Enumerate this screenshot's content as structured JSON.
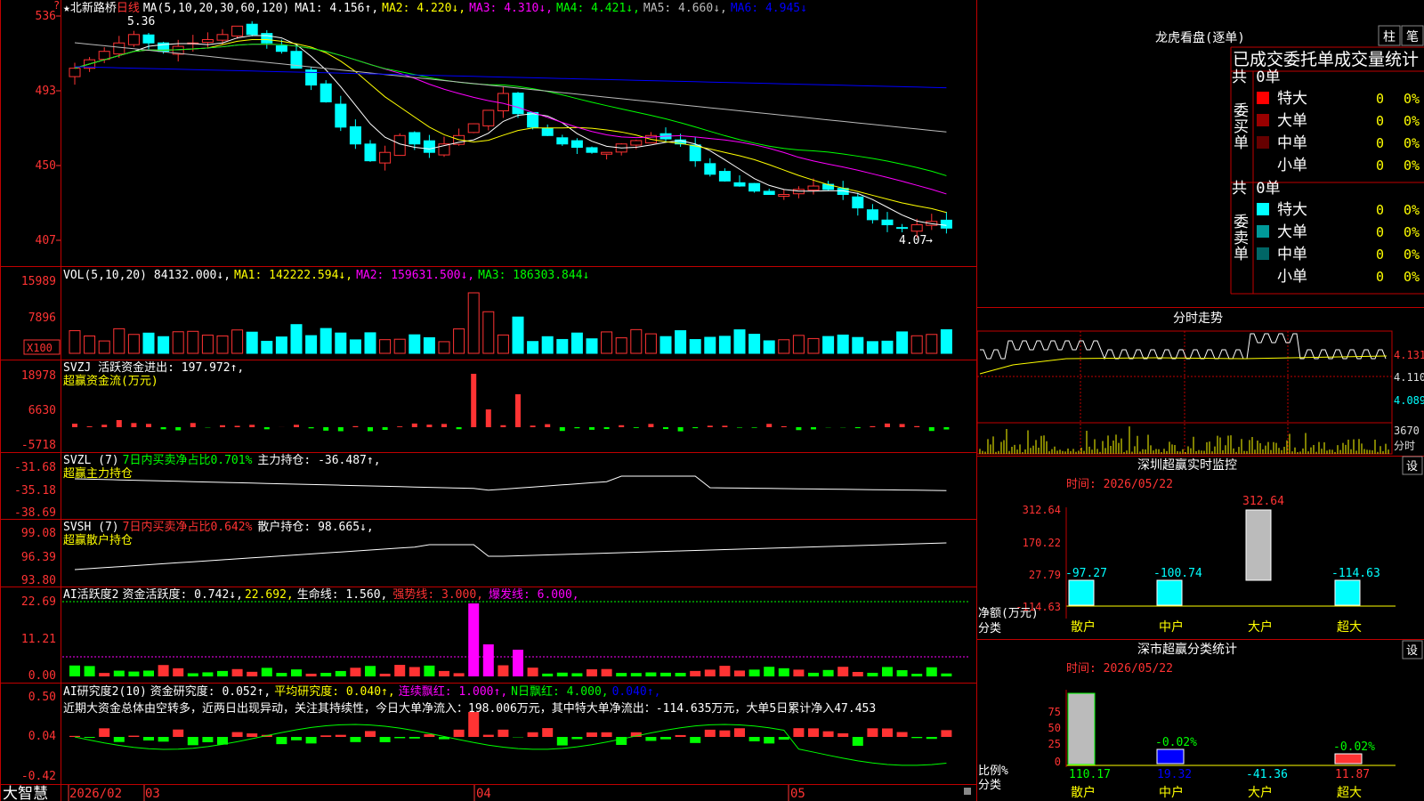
{
  "colors": {
    "up": "#ff3333",
    "down": "#00ffff",
    "frame": "#c00000",
    "ma1": "#ffffff",
    "ma2": "#ffff00",
    "ma3": "#ff00ff",
    "ma4": "#00ff00",
    "ma5": "#888888",
    "ma6": "#0000ff"
  },
  "main": {
    "star": "★",
    "stock_name": "北新路桥",
    "period": "日线",
    "ma_label": "MA(5,10,20,30,60,120)",
    "ma1": "MA1: 4.156↑,",
    "ma2": "MA2: 4.220↓,",
    "ma3": "MA3: 4.310↓,",
    "ma4": "MA4: 4.421↓,",
    "ma5": "MA5: 4.660↓,",
    "ma6": "MA6: 4.945↓",
    "y_labels": [
      "536",
      "493",
      "450",
      "407"
    ],
    "high_label": "5.36",
    "low_label": "4.07",
    "corner": "?"
  },
  "vol": {
    "label": "VOL(5,10,20)",
    "v": "84132.000↓,",
    "ma1": "MA1: 142222.594↓,",
    "ma2": "MA2: 159631.500↓,",
    "ma3": "MA3: 186303.844↓",
    "y_labels": [
      "15989",
      "7896"
    ],
    "unit": "X100"
  },
  "svzj": {
    "label": "SVZJ  活跃资金进出: 197.972↑,",
    "sub": "超赢资金流(万元)",
    "y_labels": [
      "18978",
      "6630",
      "-5718"
    ]
  },
  "svzl": {
    "label": "SVZL (7)",
    "ratio": "7日内买卖净占比0.701%",
    "hold": "主力持仓: -36.487↑,",
    "sub": "超赢主力持仓",
    "y_labels": [
      "-31.68",
      "-35.18",
      "-38.69"
    ]
  },
  "svsh": {
    "label": "SVSH (7)",
    "ratio": "7日内买卖净占比0.642%",
    "hold": "散户持仓: 98.665↓,",
    "sub": "超赢散户持仓",
    "y_labels": [
      "99.08",
      "96.39",
      "93.80"
    ]
  },
  "ai1": {
    "label": "AI活跃度2",
    "a": "资金活跃度: 0.742↓,",
    "b": "22.692,",
    "c": "生命线: 1.560,",
    "d": "强势线: 3.000,",
    "e": "爆发线: 6.000,",
    "y_labels": [
      "22.69",
      "11.21",
      "0.00"
    ]
  },
  "ai2": {
    "label": "AI研究度2(10)",
    "a": "资金研究度: 0.052↑,",
    "b": "平均研究度: 0.040↑,",
    "c": "连续飘红: 1.000↑,",
    "d": "N日飘红: 4.000,",
    "e": "0.040↑,",
    "comment": "近期大资金总体由空转多，近两日出现异动，关注其持续性，今日大单净流入：198.006万元，其中特大单净流出：-114.635万元，大单5日累计净入47.453",
    "y_labels": [
      "0.50",
      "0.04",
      "-0.42"
    ]
  },
  "xaxis": {
    "brand": "大智慧",
    "dates": [
      "2026/02",
      "03",
      "04",
      "05"
    ]
  },
  "lhb": {
    "title": "龙虎看盘(逐单)",
    "btn1": "柱",
    "btn2": "笔",
    "subtitle": "已成交委托单成交量统计",
    "buy_side": "委买单",
    "sell_side": "委卖单",
    "buy_total": "共 0单",
    "sell_total": "共 0单",
    "buy_rows": [
      {
        "name": "特大",
        "v": "0",
        "p": "0%",
        "c": "#ff0000"
      },
      {
        "name": "大单",
        "v": "0",
        "p": "0%",
        "c": "#990000"
      },
      {
        "name": "中单",
        "v": "0",
        "p": "0%",
        "c": "#660000"
      },
      {
        "name": "小单",
        "v": "0",
        "p": "0%",
        "c": ""
      }
    ],
    "sell_rows": [
      {
        "name": "特大",
        "v": "0",
        "p": "0%",
        "c": "#00ffff"
      },
      {
        "name": "大单",
        "v": "0",
        "p": "0%",
        "c": "#009999"
      },
      {
        "name": "中单",
        "v": "0",
        "p": "0%",
        "c": "#006666"
      },
      {
        "name": "小单",
        "v": "0",
        "p": "0%",
        "c": ""
      }
    ]
  },
  "fenshi": {
    "title": "分时走势",
    "labels": [
      "4.131",
      "4.110",
      "4.089",
      "3670",
      "分时"
    ]
  },
  "sz_monitor": {
    "title": "深圳超赢实时监控",
    "btn": "设",
    "time": "时间: 2026/05/22",
    "y_labels": [
      "312.64",
      "170.22",
      "27.79",
      "-114.63"
    ],
    "unit": "净额(万元)",
    "unit2": "分类",
    "values": [
      "-97.27",
      "-100.74",
      "312.64",
      "-114.63"
    ],
    "cats": [
      "散户",
      "中户",
      "大户",
      "超大"
    ]
  },
  "sz_class": {
    "title": "深市超赢分类统计",
    "btn": "设",
    "time": "时间: 2026/05/22",
    "y_labels": [
      "75",
      "50",
      "25",
      "0"
    ],
    "unit": "比例%",
    "unit2": "分类",
    "bar_labels": [
      "-0.02%",
      "-0.02%"
    ],
    "values": [
      "110.17",
      "19.32",
      "-41.36",
      "11.87"
    ],
    "cats": [
      "散户",
      "中户",
      "大户",
      "超大"
    ]
  }
}
